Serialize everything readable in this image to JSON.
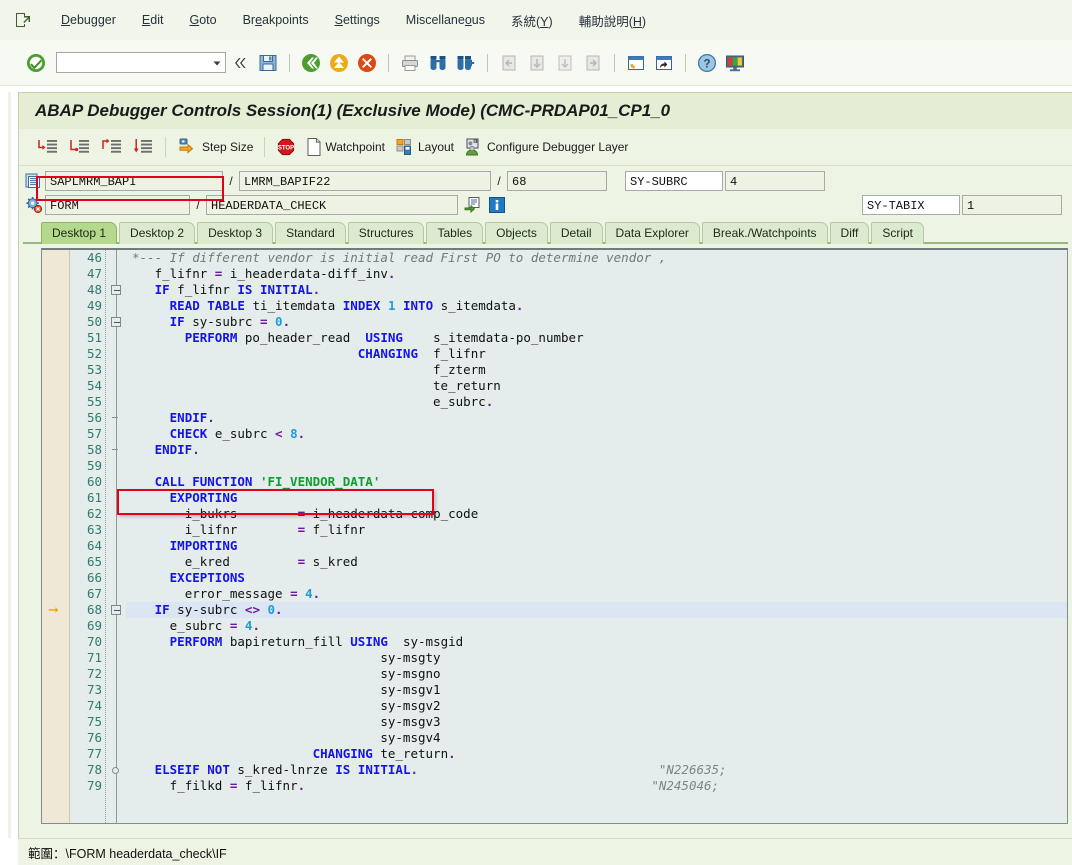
{
  "menu": {
    "system_icon": "session-icon",
    "items": [
      {
        "label": "Debugger",
        "accel": "D"
      },
      {
        "label": "Edit",
        "accel": "E"
      },
      {
        "label": "Goto",
        "accel": "G"
      },
      {
        "label": "Breakpoints",
        "accel": "e"
      },
      {
        "label": "Settings",
        "accel": "S"
      },
      {
        "label": "Miscellaneous",
        "accel": "o"
      },
      {
        "label": "系統(Y)",
        "accel": "Y"
      },
      {
        "label": "輔助說明(H)",
        "accel": "H"
      }
    ]
  },
  "toolbar": {
    "enter_icon": "green-check-enter-icon",
    "command_field_value": "",
    "command_field_placeholder": "",
    "dropdown_icon": "chevron-down-icon",
    "collapse_icon": "double-chevron-left-icon",
    "buttons": [
      {
        "name": "save-button",
        "icon": "floppy-save-icon"
      },
      {
        "name": "back-button",
        "icon": "green-back-arrow-icon"
      },
      {
        "name": "exit-button",
        "icon": "yellow-exit-up-arrow-icon"
      },
      {
        "name": "cancel-button",
        "icon": "red-cancel-x-icon"
      },
      {
        "name": "print-button",
        "icon": "printer-icon"
      },
      {
        "name": "find-button",
        "icon": "binoculars-find-icon"
      },
      {
        "name": "find-next-button",
        "icon": "binoculars-find-next-icon"
      },
      {
        "name": "first-page-button",
        "icon": "first-page-icon"
      },
      {
        "name": "prev-page-button",
        "icon": "previous-page-icon"
      },
      {
        "name": "next-page-button",
        "icon": "next-page-icon"
      },
      {
        "name": "last-page-button",
        "icon": "last-page-icon"
      },
      {
        "name": "create-session-button",
        "icon": "new-session-window-icon"
      },
      {
        "name": "shortcut-button",
        "icon": "create-shortcut-window-icon"
      },
      {
        "name": "help-button",
        "icon": "question-help-icon"
      },
      {
        "name": "layout-menu-button",
        "icon": "customize-local-layout-icon"
      }
    ]
  },
  "window": {
    "title": "ABAP Debugger Controls Session(1)  (Exclusive Mode) (CMC-PRDAP01_CP1_0"
  },
  "debugger_toolbar": {
    "buttons": [
      {
        "name": "step-into-button",
        "icon": "step-into-icon",
        "label": ""
      },
      {
        "name": "step-over-button",
        "icon": "step-over-icon",
        "label": ""
      },
      {
        "name": "return-button",
        "icon": "step-return-icon",
        "label": ""
      },
      {
        "name": "continue-button",
        "icon": "continue-run-icon",
        "label": ""
      },
      {
        "name": "step-size-button",
        "icon": "step-size-icon",
        "label": "Step Size"
      },
      {
        "name": "stop-button",
        "icon": "stop-sign-icon",
        "label": ""
      },
      {
        "name": "watchpoint-button",
        "icon": "watchpoint-page-icon",
        "label": "Watchpoint"
      },
      {
        "name": "layout-button",
        "icon": "layout-grid-icon",
        "label": "Layout"
      },
      {
        "name": "configure-debugger-layer-button",
        "icon": "configure-layer-icon",
        "label": "Configure Debugger Layer"
      }
    ]
  },
  "fields": {
    "row1": {
      "icon": "program-stack-icon",
      "program": "SAPLMRM_BAPI",
      "include": "LMRM_BAPIF22",
      "line": "68",
      "sysfield_label": "SY-SUBRC",
      "sysfield_value": "4",
      "sep": "/"
    },
    "row2": {
      "icon": "event-gear-icon",
      "event_type": "FORM",
      "event_name": "HEADERDATA_CHECK",
      "goto_icon": "goto-source-icon",
      "info_icon": "information-icon",
      "sysfield_label": "SY-TABIX",
      "sysfield_value": "1",
      "sep": "/"
    }
  },
  "tabs": [
    {
      "label": "Desktop 1",
      "active": true
    },
    {
      "label": "Desktop 2",
      "active": false
    },
    {
      "label": "Desktop 3",
      "active": false
    },
    {
      "label": "Standard",
      "active": false
    },
    {
      "label": "Structures",
      "active": false
    },
    {
      "label": "Tables",
      "active": false
    },
    {
      "label": "Objects",
      "active": false
    },
    {
      "label": "Detail",
      "active": false
    },
    {
      "label": "Data Explorer",
      "active": false
    },
    {
      "label": "Break./Watchpoints",
      "active": false
    },
    {
      "label": "Diff",
      "active": false
    },
    {
      "label": "Script",
      "active": false
    }
  ],
  "code": {
    "first_line": 46,
    "current_line": 68,
    "highlight_line": 60,
    "accent_highlight_color": "#e3001b",
    "current_line_bg": "#dbe5f3",
    "lines": [
      {
        "n": 46,
        "fold": "",
        "html": "<span class=\"cm\">*--- If different vendor is initial read First PO to determine vendor ,</span>"
      },
      {
        "n": 47,
        "fold": "",
        "html": "   <span class=\"id\">f_lifnr</span> <span class=\"pn\">=</span> <span class=\"id\">i_headerdata-diff_inv</span><span class=\"pn\">.</span>"
      },
      {
        "n": 48,
        "fold": "box",
        "html": "   <span class=\"kw\">IF</span> <span class=\"id\">f_lifnr</span> <span class=\"kw\">IS INITIAL</span><span class=\"pn\">.</span>"
      },
      {
        "n": 49,
        "fold": "",
        "html": "     <span class=\"kw\">READ TABLE</span> <span class=\"id\">ti_itemdata</span> <span class=\"kw\">INDEX</span> <span class=\"num\">1</span> <span class=\"kw\">INTO</span> <span class=\"id\">s_itemdata</span><span class=\"pn\">.</span>"
      },
      {
        "n": 50,
        "fold": "box",
        "html": "     <span class=\"kw\">IF</span> <span class=\"id\">sy-subrc</span> <span class=\"pn\">=</span> <span class=\"num\">0</span><span class=\"pn\">.</span>"
      },
      {
        "n": 51,
        "fold": "",
        "html": "       <span class=\"kw\">PERFORM</span> <span class=\"id\">po_header_read</span>  <span class=\"kw\">USING</span>    <span class=\"id\">s_itemdata-po_number</span>"
      },
      {
        "n": 52,
        "fold": "",
        "html": "                              <span class=\"kw\">CHANGING</span>  <span class=\"id\">f_lifnr</span>"
      },
      {
        "n": 53,
        "fold": "",
        "html": "                                        <span class=\"id\">f_zterm</span>"
      },
      {
        "n": 54,
        "fold": "",
        "html": "                                        <span class=\"id\">te_return</span>"
      },
      {
        "n": 55,
        "fold": "",
        "html": "                                        <span class=\"id\">e_subrc</span><span class=\"pn\">.</span>"
      },
      {
        "n": 56,
        "fold": "tick",
        "html": "     <span class=\"kw\">ENDIF</span><span class=\"pn\">.</span>"
      },
      {
        "n": 57,
        "fold": "",
        "html": "     <span class=\"kw\">CHECK</span> <span class=\"id\">e_subrc</span> <span class=\"pn\">&lt;</span> <span class=\"num\">8</span><span class=\"pn\">.</span>"
      },
      {
        "n": 58,
        "fold": "tick",
        "html": "   <span class=\"kw\">ENDIF</span><span class=\"pn\">.</span>"
      },
      {
        "n": 59,
        "fold": "",
        "html": ""
      },
      {
        "n": 60,
        "fold": "",
        "html": "   <span class=\"kw\">CALL FUNCTION</span> <span class=\"str\">'FI_VENDOR_DATA'</span>"
      },
      {
        "n": 61,
        "fold": "",
        "html": "     <span class=\"kw\">EXPORTING</span>"
      },
      {
        "n": 62,
        "fold": "",
        "html": "       <span class=\"id\">i_bukrs</span>        <span class=\"pn\">=</span> <span class=\"id\">i_headerdata-comp_code</span>"
      },
      {
        "n": 63,
        "fold": "",
        "html": "       <span class=\"id\">i_lifnr</span>        <span class=\"pn\">=</span> <span class=\"id\">f_lifnr</span>"
      },
      {
        "n": 64,
        "fold": "",
        "html": "     <span class=\"kw\">IMPORTING</span>"
      },
      {
        "n": 65,
        "fold": "",
        "html": "       <span class=\"id\">e_kred</span>         <span class=\"pn\">=</span> <span class=\"id\">s_kred</span>"
      },
      {
        "n": 66,
        "fold": "",
        "html": "     <span class=\"kw\">EXCEPTIONS</span>"
      },
      {
        "n": 67,
        "fold": "",
        "html": "       <span class=\"id\">error_message</span> <span class=\"pn\">=</span> <span class=\"num\">4</span><span class=\"pn\">.</span>"
      },
      {
        "n": 68,
        "fold": "box",
        "cur": true,
        "html": "   <span class=\"kw\">IF</span> <span class=\"id\">sy-subrc</span> <span class=\"pn\">&lt;&gt;</span> <span class=\"num\">0</span><span class=\"pn\">.</span>"
      },
      {
        "n": 69,
        "fold": "",
        "html": "     <span class=\"id\">e_subrc</span> <span class=\"pn\">=</span> <span class=\"num\">4</span><span class=\"pn\">.</span>"
      },
      {
        "n": 70,
        "fold": "",
        "html": "     <span class=\"kw\">PERFORM</span> <span class=\"id\">bapireturn_fill</span> <span class=\"kw\">USING</span>  <span class=\"id\">sy-msgid</span>"
      },
      {
        "n": 71,
        "fold": "",
        "html": "                                 <span class=\"id\">sy-msgty</span>"
      },
      {
        "n": 72,
        "fold": "",
        "html": "                                 <span class=\"id\">sy-msgno</span>"
      },
      {
        "n": 73,
        "fold": "",
        "html": "                                 <span class=\"id\">sy-msgv1</span>"
      },
      {
        "n": 74,
        "fold": "",
        "html": "                                 <span class=\"id\">sy-msgv2</span>"
      },
      {
        "n": 75,
        "fold": "",
        "html": "                                 <span class=\"id\">sy-msgv3</span>"
      },
      {
        "n": 76,
        "fold": "",
        "html": "                                 <span class=\"id\">sy-msgv4</span>"
      },
      {
        "n": 77,
        "fold": "",
        "html": "                        <span class=\"kw\">CHANGING</span> <span class=\"id\">te_return</span><span class=\"pn\">.</span>"
      },
      {
        "n": 78,
        "fold": "circ",
        "html": "   <span class=\"kw\">ELSEIF</span> <span class=\"kw\">NOT</span> <span class=\"id\">s_kred-lnrze</span> <span class=\"kw\">IS INITIAL</span><span class=\"pn\">.</span>                                <span class=\"cm2\">\"N226635;</span>"
      },
      {
        "n": 79,
        "fold": "",
        "html": "     <span class=\"id\">f_filkd</span> <span class=\"pn\">=</span> <span class=\"id\">f_lifnr</span><span class=\"pn\">.</span>                                              <span class=\"cm2\">\"N245046;</span>"
      }
    ]
  },
  "statusbar": {
    "text": "範圍：\\FORM headerdata_check\\IF"
  }
}
